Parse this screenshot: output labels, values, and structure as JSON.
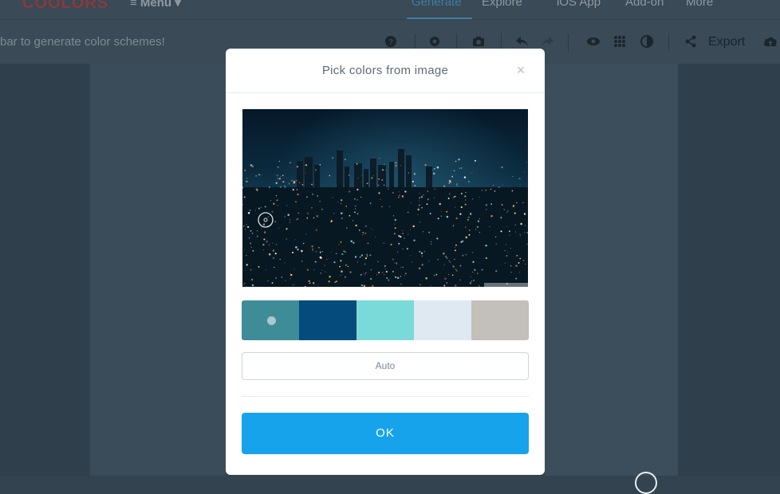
{
  "app": {
    "logo": "COOLORS",
    "menu": "≡ Menu ▾"
  },
  "nav": {
    "items": [
      "Generate",
      "Explore",
      "iOS App",
      "Add-on",
      "More"
    ],
    "active_index": 0
  },
  "toolbar": {
    "hint": "bar to generate color schemes!",
    "export_label": "Export"
  },
  "modal": {
    "title": "Pick colors from image",
    "close_glyph": "×",
    "palette": [
      "#3f8c99",
      "#054b7c",
      "#7adad9",
      "#dfe9f2",
      "#c3bfba"
    ],
    "auto_label": "Auto",
    "ok_label": "OK"
  },
  "background_columns": [
    "#2f3f4c",
    "#3a4b59",
    "#3b4d5b",
    "#3c4e5c",
    "#2f3f4c"
  ]
}
